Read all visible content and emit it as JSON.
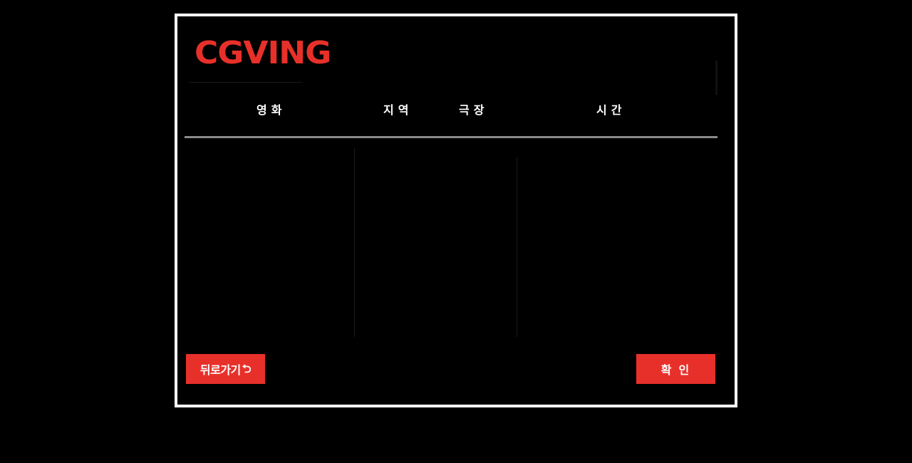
{
  "app": {
    "logo_text": "CGVING"
  },
  "columns": {
    "movie": "영화",
    "region": "지역",
    "theater": "극장",
    "time": "시간"
  },
  "lists": {
    "movies": [],
    "regions": [],
    "theaters": [],
    "times": []
  },
  "buttons": {
    "back_label": "뒤로가기",
    "back_icon": "undo-arrow-icon",
    "back_icon_glyph": "⮌",
    "confirm_label": "확인"
  },
  "colors": {
    "accent": "#e8302a",
    "background": "#000000",
    "frame_border": "#ffffff",
    "divider": "#8a8a8a"
  }
}
